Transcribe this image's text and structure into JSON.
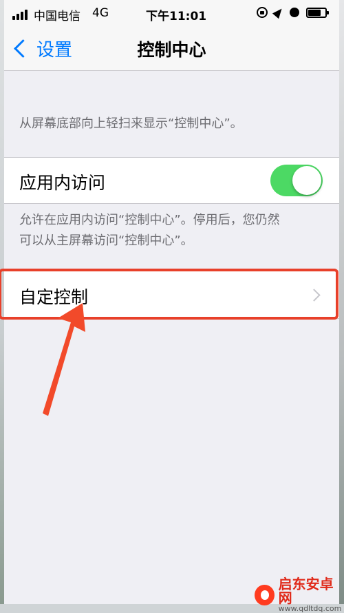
{
  "status_bar": {
    "carrier": "中国电信",
    "network": "4G",
    "time": "下午11:01"
  },
  "nav": {
    "back_label": "设置",
    "title": "控制中心"
  },
  "header_note": "从屏幕底部向上轻扫来显示“控制中心”。",
  "in_app_access": {
    "label": "应用内访问",
    "toggle_on": true,
    "description_line1": "允许在应用内访问“控制中心”。停用后，您仍然",
    "description_line2": "可以从主屏幕访问“控制中心”。"
  },
  "customize": {
    "label": "自定控制"
  },
  "watermark": {
    "name": "启东安卓网",
    "url": "www.qdltdq.com"
  },
  "colors": {
    "accent": "#007aff",
    "toggle_on": "#4cd964",
    "highlight": "#e8402a"
  }
}
